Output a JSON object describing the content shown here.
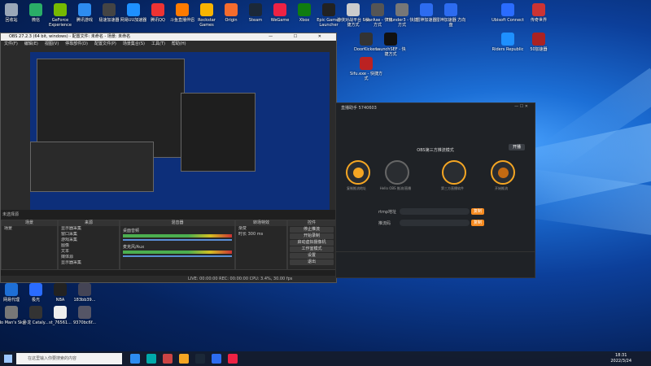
{
  "desktop": {
    "top_icons": [
      {
        "label": "回收站",
        "color": "#9aa7b8"
      },
      {
        "label": "微信",
        "color": "#2aae67"
      },
      {
        "label": "GeForce Experience",
        "color": "#76b900"
      },
      {
        "label": "腾讯游戏",
        "color": "#2d8cf0"
      },
      {
        "label": "极速加速器",
        "color": "#444"
      },
      {
        "label": "网易UU加速器",
        "color": "#1e90ff"
      },
      {
        "label": "腾讯QQ",
        "color": "#e33"
      },
      {
        "label": "斗鱼直播伴侣",
        "color": "#ff7b00"
      },
      {
        "label": "Rockstar Games",
        "color": "#f8b400"
      },
      {
        "label": "Origin",
        "color": "#f56c2d"
      },
      {
        "label": "Steam",
        "color": "#1b2838"
      },
      {
        "label": "WeGame",
        "color": "#e24"
      },
      {
        "label": "Xbox",
        "color": "#107c10"
      },
      {
        "label": "Epic Games Launcher",
        "color": "#222"
      },
      {
        "label": "游侠对战平台 - 快捷方式",
        "color": "#ccc"
      },
      {
        "label": "SwarAxe - 快捷方式",
        "color": "#555"
      },
      {
        "label": "Thunder3 - 快捷方式",
        "color": "#777"
      },
      {
        "label": "雷神加速器",
        "color": "#2d6cf0"
      },
      {
        "label": "雷神加速器 方向盘",
        "color": "#2d6cf0"
      }
    ],
    "right_icons": [
      {
        "label": "Ubisoft Connect",
        "color": "#2a6cff"
      },
      {
        "label": "传奇世界",
        "color": "#c33"
      },
      {
        "label": "Riders Republic",
        "color": "#1e90ff"
      },
      {
        "label": "50加速器",
        "color": "#aa2222"
      }
    ],
    "mid_icons": [
      {
        "label": "DoorKickers",
        "color": "#333"
      },
      {
        "label": "LaunchSEF - 快捷方式",
        "color": "#111"
      },
      {
        "label": "Sifu.exe - 快捷方式",
        "color": "#bb2222"
      }
    ],
    "bottom_icons": [
      {
        "label": "网易代理",
        "color": "#1e6fd6"
      },
      {
        "label": "极光",
        "color": "#2a6cff"
      },
      {
        "label": "NBA",
        "color": "#222"
      },
      {
        "label": "183bb39...",
        "color": "#445"
      },
      {
        "label": "No Man's Sky",
        "color": "#777"
      },
      {
        "label": "卧龙 Cataly...",
        "color": "#333"
      },
      {
        "label": "st_76561...",
        "color": "#eee"
      },
      {
        "label": "9370bc6f...",
        "color": "#556"
      }
    ]
  },
  "obs": {
    "title": "OBS 27.2.3 (64 bit, windows) - 配置文件: 未命名 - 场景: 未命名",
    "menu": [
      "文件(F)",
      "编辑(E)",
      "视图(V)",
      "停靠部件(D)",
      "配置文件(P)",
      "场景集合(S)",
      "工具(T)",
      "帮助(H)"
    ],
    "panels": {
      "scenes": {
        "title": "场景",
        "items": [
          "场景"
        ]
      },
      "sources": {
        "title": "来源",
        "items": [
          "显示器采集",
          "窗口采集",
          "游戏采集",
          "图像",
          "文本",
          "媒体源",
          "显示器采集"
        ]
      },
      "mixer": {
        "title": "混音器",
        "tracks": [
          "桌面音频",
          "麦克风/Aux"
        ]
      },
      "transitions": {
        "title": "转场特效",
        "type": "渐变",
        "duration_label": "时长",
        "duration": "300 ms"
      },
      "controls": {
        "title": "控件",
        "buttons": [
          "停止推流",
          "开始录制",
          "启动虚拟摄像机",
          "工作室模式",
          "设置",
          "退出"
        ]
      }
    },
    "status": "LIVE: 00:00:00   REC: 00:00:00   CPU: 3.4%, 30.00 fps",
    "no_source_label": "未选择源"
  },
  "helper": {
    "title": "直播助手 5740603",
    "section": "OBS第三方推流模式",
    "start_label": "开播",
    "steps": [
      "复制推流地址",
      "Hello OBS 推流/直播",
      "第三方直播软件",
      "开始推流"
    ],
    "rtmp_label": "rtmp地址",
    "key_label": "推流码",
    "copy_label": "复制"
  },
  "taskbar": {
    "search_placeholder": "在这里输入你要搜索的内容",
    "time": "18:31",
    "date": "2022/3/24",
    "icons": [
      "#2d8cf0",
      "#0aa",
      "#c44",
      "#f5a623",
      "#1b2838",
      "#2d6cf0",
      "#e24"
    ]
  }
}
